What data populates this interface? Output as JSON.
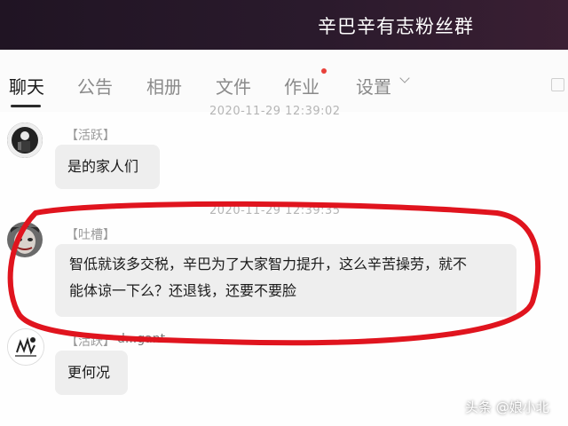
{
  "window": {
    "title": "辛巴辛有志粉丝群"
  },
  "tabs": [
    {
      "label": "聊天",
      "active": true
    },
    {
      "label": "公告",
      "active": false
    },
    {
      "label": "相册",
      "active": false
    },
    {
      "label": "文件",
      "active": false
    },
    {
      "label": "作业",
      "active": false,
      "badge": "red-dot"
    },
    {
      "label": "设置",
      "active": false,
      "icon": "chevron-down-icon"
    }
  ],
  "messages": [
    {
      "timestamp": "2020-11-29 12:39:02",
      "badge": "【活跃】",
      "text": "是的家人们",
      "avatar": "dark-figure-avatar"
    },
    {
      "timestamp": "2020-11-29 12:39:35",
      "badge": "【吐槽】",
      "text_line1": "智低就该多交税，辛巴为了大家智力提升，这么辛苦操劳，就不",
      "text_line2": "能体谅一下么？还退钱，还要不要脸",
      "avatar": "joker-avatar"
    },
    {
      "badge": "【活跃】",
      "sender_name": "d...gant",
      "text": "更何况",
      "avatar": "sketch-avatar"
    }
  ],
  "watermark": "头条 @娘小北",
  "colors": {
    "titlebar": "#201423",
    "bubble": "#eeeeee",
    "annotation": "#e0141e",
    "badge": "#e8413a"
  }
}
